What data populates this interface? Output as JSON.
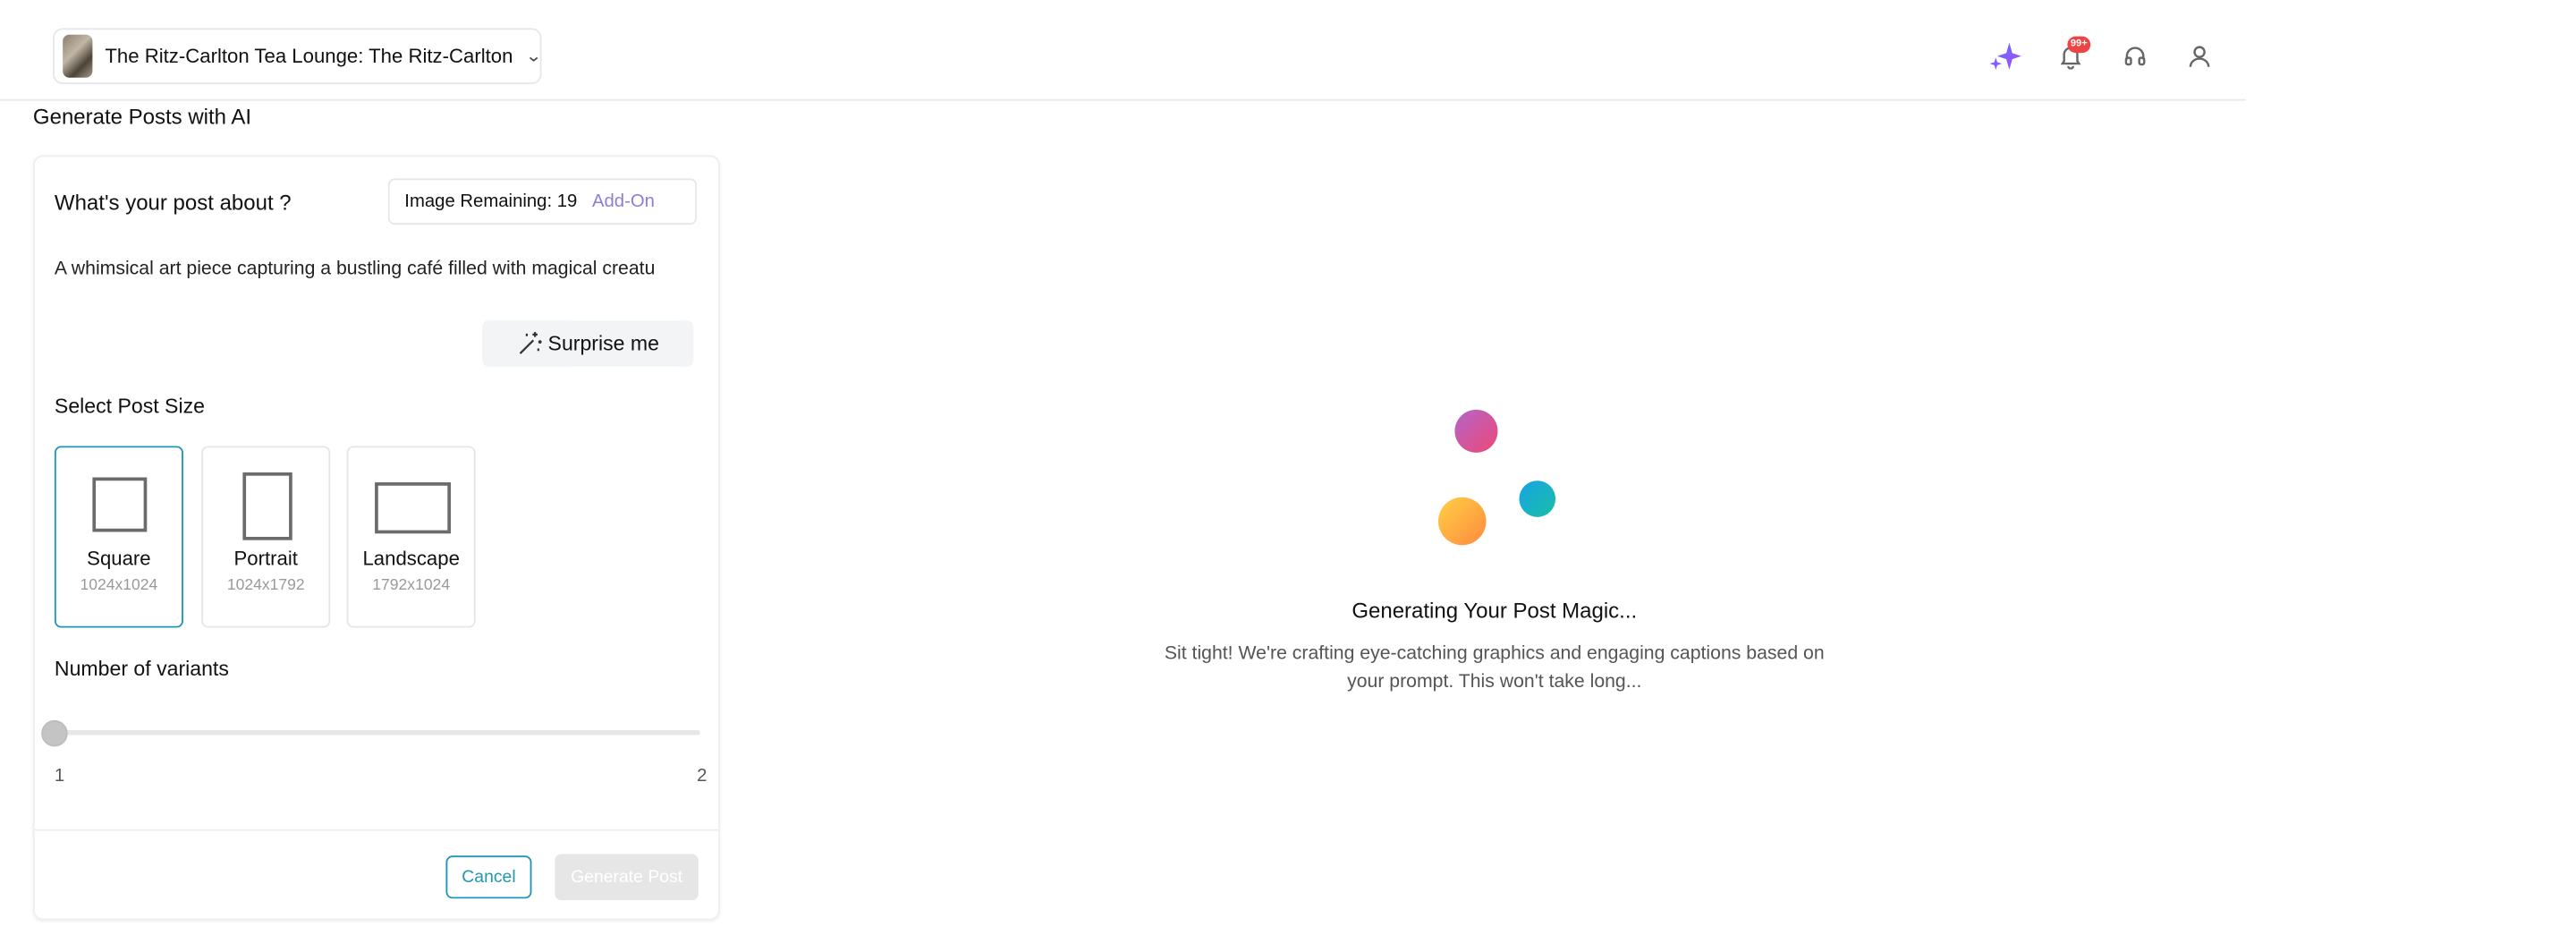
{
  "header": {
    "business_name": "The Ritz-Carlton Tea Lounge: The Ritz-Carlton",
    "notification_count": "99+",
    "icons": [
      "sparkles-icon",
      "bell-icon",
      "headset-icon",
      "user-icon"
    ]
  },
  "page": {
    "title": "Generate Posts with AI"
  },
  "form": {
    "question_label": "What's your post about ?",
    "image_remaining": "Image Remaining: 19",
    "addon_label": "Add-On",
    "prompt_text": "A whimsical art piece capturing a bustling café filled with magical creatu",
    "surprise_label": "Surprise me",
    "size_label": "Select Post Size",
    "sizes": [
      {
        "name": "Square",
        "dim": "1024x1024",
        "selected": true
      },
      {
        "name": "Portrait",
        "dim": "1024x1792",
        "selected": false
      },
      {
        "name": "Landscape",
        "dim": "1792x1024",
        "selected": false
      }
    ],
    "variants_label": "Number of variants",
    "variants_min": "1",
    "variants_max": "2",
    "variants_value": 1,
    "cancel_label": "Cancel",
    "generate_label": "Generate Post"
  },
  "status": {
    "title": "Generating Your Post Magic...",
    "line1": "Sit tight! We're crafting eye-catching graphics and engaging captions based on",
    "line2": "your prompt. This won't take long..."
  },
  "colors": {
    "accent": "#2196b3",
    "addon": "#8b7fd8",
    "badge": "#ef4444",
    "sparkle": "#7c5cff"
  }
}
